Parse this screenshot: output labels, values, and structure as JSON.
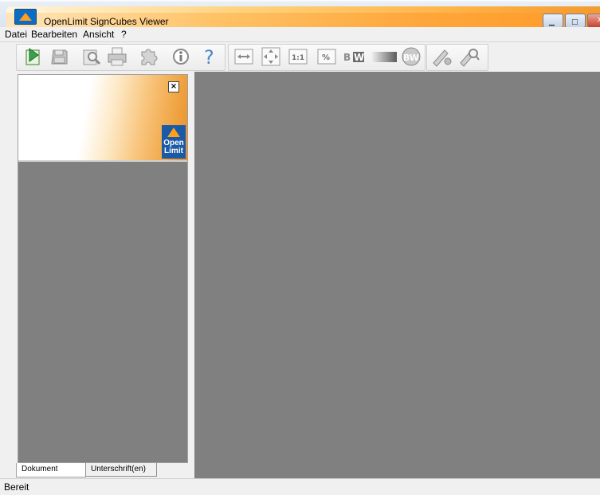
{
  "window": {
    "title": "OpenLimit SignCubes Viewer"
  },
  "menu": {
    "items": [
      "Datei",
      "Bearbeiten",
      "Ansicht",
      "?"
    ]
  },
  "toolbar": {
    "buttons": [
      "open-document-icon",
      "save-icon",
      "preview-icon",
      "print-icon",
      "puzzle-icon",
      "info-icon",
      "help-icon",
      "fit-width-icon",
      "fit-page-icon",
      "actual-size-icon",
      "percent-zoom-icon",
      "black-white-icon",
      "grayscale-icon",
      "bw-toggle-icon",
      "verify-signature-icon",
      "signature-search-icon"
    ],
    "labels": {
      "actual_size": "1:1",
      "percent": "%",
      "bw_b": "B",
      "bw_w": "W",
      "bw2": "BW"
    }
  },
  "banner": {
    "close_label": "×",
    "logo_line1": "Open",
    "logo_line2": "Limit"
  },
  "tabs": [
    {
      "label": "Dokument",
      "active": true
    },
    {
      "label": "Unterschrift(en)",
      "active": false
    }
  ],
  "status": {
    "text": "Bereit"
  },
  "colors": {
    "title_orange": "#ffa63a",
    "logo_blue": "#1a5aa6",
    "workspace_gray": "#808080"
  }
}
